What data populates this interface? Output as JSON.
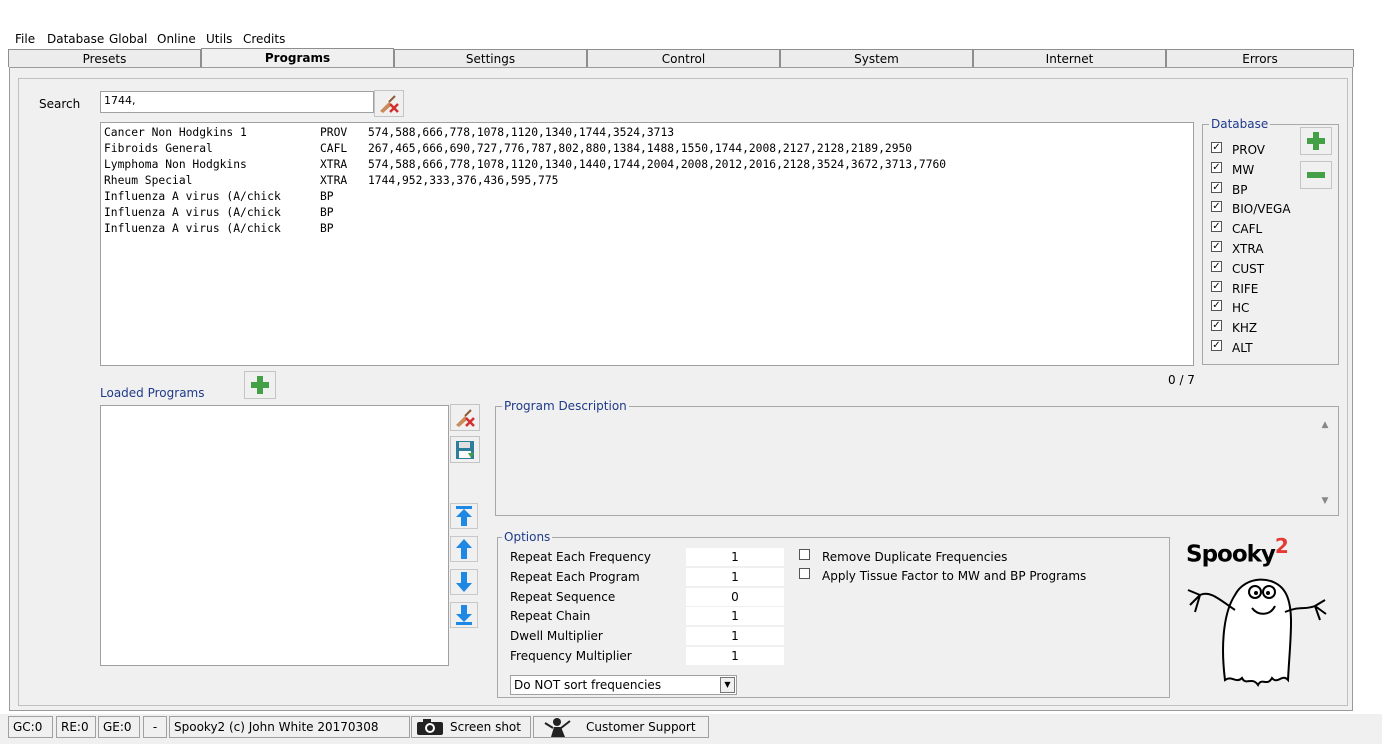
{
  "menu": [
    "File",
    "Database",
    "Global",
    "Online",
    "Utils",
    "Credits"
  ],
  "tabs": [
    "Presets",
    "Programs",
    "Settings",
    "Control",
    "System",
    "Internet",
    "Errors"
  ],
  "active_tab": "Programs",
  "search": {
    "label": "Search",
    "value": "1744,"
  },
  "results": [
    {
      "name": "Cancer Non Hodgkins 1",
      "db": "PROV",
      "freqs": "574,588,666,778,1078,1120,1340,1744,3524,3713"
    },
    {
      "name": "Fibroids General",
      "db": "CAFL",
      "freqs": "267,465,666,690,727,776,787,802,880,1384,1488,1550,1744,2008,2127,2128,2189,2950"
    },
    {
      "name": "Lymphoma Non Hodgkins",
      "db": "XTRA",
      "freqs": "574,588,666,778,1078,1120,1340,1440,1744,2004,2008,2012,2016,2128,3524,3672,3713,7760"
    },
    {
      "name": "Rheum Special",
      "db": "XTRA",
      "freqs": "1744,952,333,376,436,595,775"
    },
    {
      "name": "Influenza A virus (A/chick",
      "db": "BP",
      "freqs": ""
    },
    {
      "name": "Influenza A virus (A/chick",
      "db": "BP",
      "freqs": ""
    },
    {
      "name": "Influenza A virus (A/chick",
      "db": "BP",
      "freqs": ""
    }
  ],
  "database": {
    "legend": "Database",
    "items": [
      "PROV",
      "MW",
      "BP",
      "BIO/VEGA",
      "CAFL",
      "XTRA",
      "CUST",
      "RIFE",
      "HC",
      "KHZ",
      "ALT"
    ],
    "check_mark": "✓"
  },
  "count_label": "0 / 7",
  "loaded_programs_label": "Loaded Programs",
  "program_description_label": "Program Description",
  "options": {
    "legend": "Options",
    "rows": [
      {
        "label": "Repeat Each Frequency",
        "value": "1"
      },
      {
        "label": "Repeat Each Program",
        "value": "1"
      },
      {
        "label": "Repeat Sequence",
        "value": "0"
      },
      {
        "label": "Repeat Chain",
        "value": "1"
      },
      {
        "label": "Dwell Multiplier",
        "value": "1"
      },
      {
        "label": "Frequency Multiplier",
        "value": "1"
      }
    ],
    "checkboxes": [
      "Remove Duplicate Frequencies",
      "Apply Tissue Factor to MW and BP Programs"
    ],
    "sort_select": "Do NOT sort frequencies"
  },
  "logo_text": "Spooky",
  "logo_sup": "2",
  "status": {
    "gc": "GC:0",
    "re": "RE:0",
    "ge": "GE:0",
    "dash": "-",
    "copyright": "Spooky2 (c) John White 20170308",
    "screenshot": "Screen shot",
    "support": "Customer Support"
  },
  "colors": {
    "accent_blue": "#1f3a8a",
    "icon_blue": "#1e88e5",
    "plus_green": "#43a047",
    "logo_red": "#e53935"
  }
}
